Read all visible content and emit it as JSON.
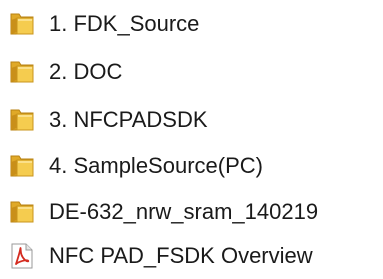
{
  "items": [
    {
      "label": "1. FDK_Source",
      "icon": "folder-icon"
    },
    {
      "label": "2. DOC",
      "icon": "folder-icon"
    },
    {
      "label": "3. NFCPADSDK",
      "icon": "folder-icon"
    },
    {
      "label": "4. SampleSource(PC)",
      "icon": "folder-icon"
    },
    {
      "label": "DE-632_nrw_sram_140219",
      "icon": "folder-icon"
    },
    {
      "label": "NFC PAD_FSDK Overview",
      "icon": "pdf-file-icon"
    }
  ],
  "colors": {
    "folder_back": "#e0a928",
    "folder_front": "#f5cc4f",
    "folder_edge": "#b98212",
    "pdf_red": "#d42b20",
    "text": "#1a1a1a"
  }
}
